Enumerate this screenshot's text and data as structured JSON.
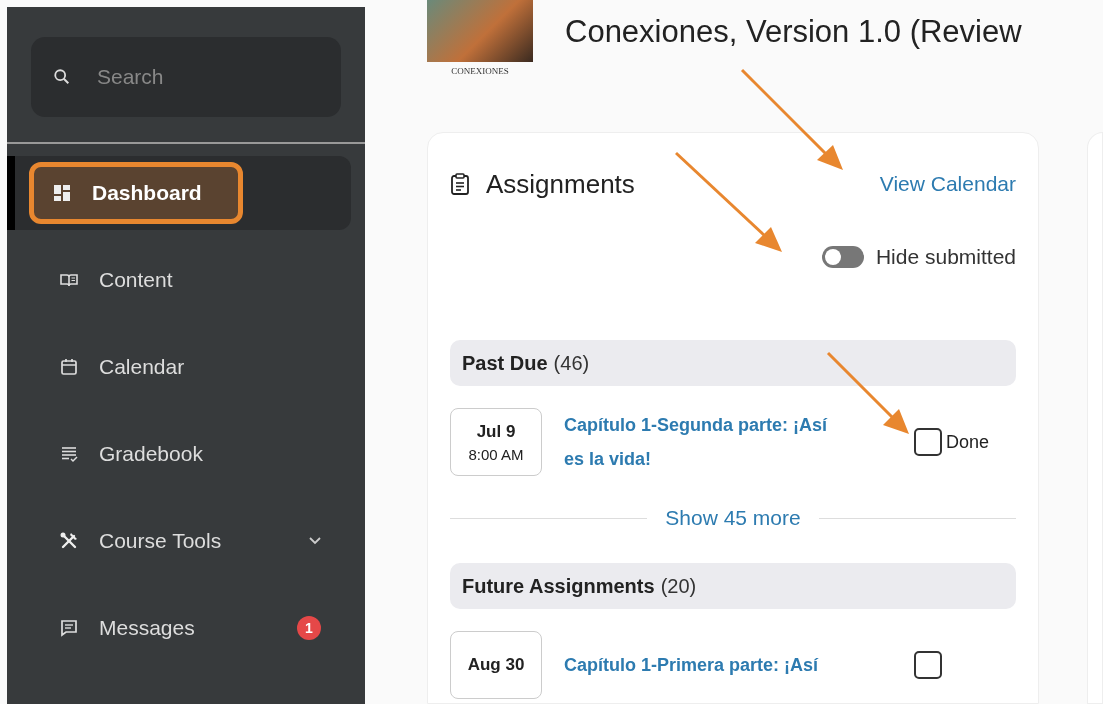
{
  "sidebar": {
    "search": {
      "placeholder": "Search"
    },
    "items": [
      {
        "label": "Dashboard",
        "kind": "dashboard",
        "selected": true
      },
      {
        "label": "Content",
        "kind": "book",
        "selected": false
      },
      {
        "label": "Calendar",
        "kind": "calendar",
        "selected": false
      },
      {
        "label": "Gradebook",
        "kind": "list",
        "selected": false
      },
      {
        "label": "Course Tools",
        "kind": "tools",
        "selected": false,
        "expanded": false
      },
      {
        "label": "Messages",
        "kind": "message",
        "selected": false,
        "badge": "1"
      }
    ]
  },
  "header": {
    "logo_caption": "CONEXIONES",
    "title": "Conexiones, Version 1.0 (Review"
  },
  "assignments": {
    "title": "Assignments",
    "link": "View Calendar",
    "hide_submitted": {
      "label": "Hide submitted",
      "on": false
    },
    "groups": [
      {
        "name": "Past Due",
        "count": "(46)",
        "items": [
          {
            "month_day": "Jul 9",
            "time": "8:00 AM",
            "title": "Capítulo 1-Segunda parte: ¡Así es la vida!",
            "done": {
              "label": "Done",
              "checked": false
            }
          }
        ],
        "more": "Show 45 more"
      },
      {
        "name": "Future Assignments",
        "count": "(20)",
        "items": [
          {
            "month_day": "Aug 30",
            "title": "Capítulo 1-Primera parte: ¡Así",
            "done": {
              "checked": false
            }
          }
        ]
      }
    ]
  }
}
